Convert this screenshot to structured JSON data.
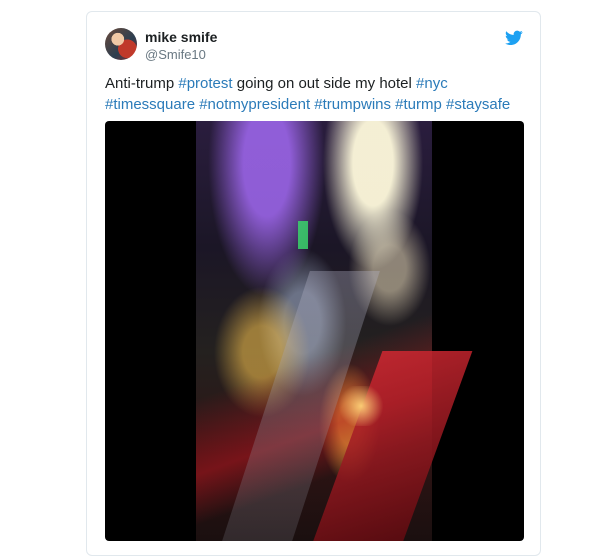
{
  "user": {
    "name": "mike smife",
    "handle": "@Smife10"
  },
  "tweet": {
    "segments": [
      {
        "text": "Anti-trump ",
        "tag": false
      },
      {
        "text": "#protest",
        "tag": true
      },
      {
        "text": " going on out side my hotel ",
        "tag": false
      },
      {
        "text": "#nyc",
        "tag": true
      },
      {
        "text": " ",
        "tag": false
      },
      {
        "text": "#timessquare",
        "tag": true
      },
      {
        "text": " ",
        "tag": false
      },
      {
        "text": "#notmypresident",
        "tag": true
      },
      {
        "text": " ",
        "tag": false
      },
      {
        "text": "#trumpwins",
        "tag": true
      },
      {
        "text": " ",
        "tag": false
      },
      {
        "text": "#turmp",
        "tag": true
      },
      {
        "text": " ",
        "tag": false
      },
      {
        "text": "#staysafe",
        "tag": true
      }
    ]
  },
  "icons": {
    "brand": "twitter-bird-icon",
    "brand_color": "#1da1f2",
    "link_color": "#2b7bb9"
  }
}
